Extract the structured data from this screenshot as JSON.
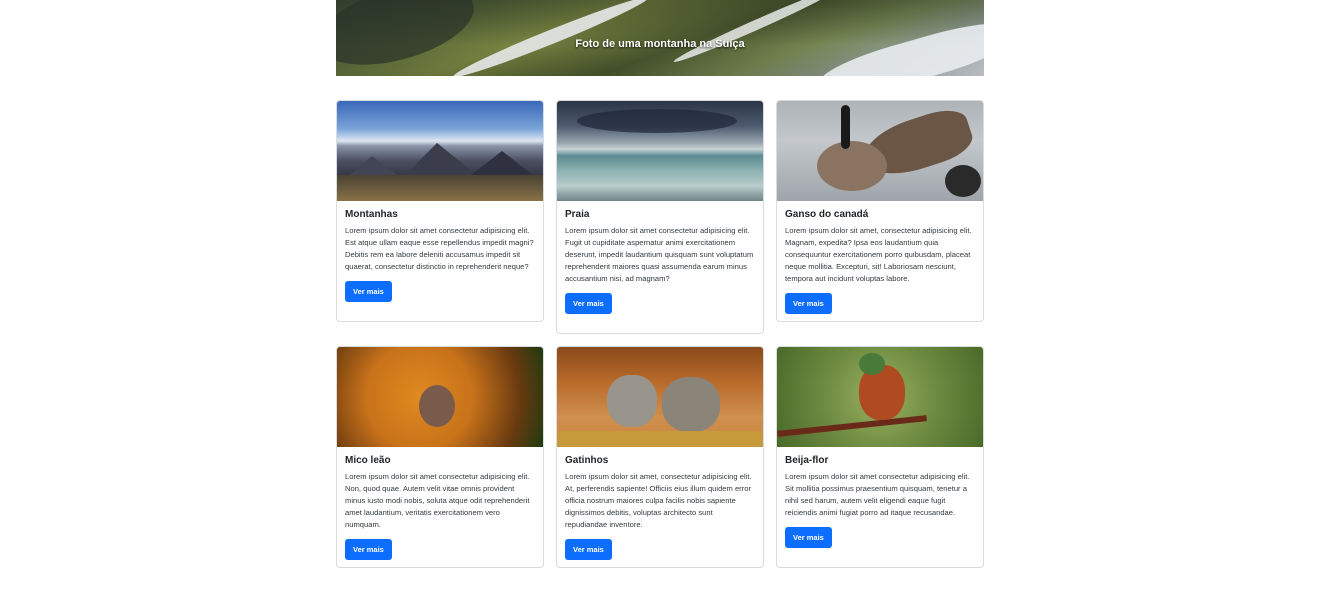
{
  "hero": {
    "caption": "Foto de uma montanha na Suíça"
  },
  "cards": [
    {
      "title": "Montanhas",
      "text": "Lorem ipsum dolor sit amet consectetur adipisicing elit. Est atque ullam eaque esse repellendus impedit magni? Debitis rem ea labore deleniti accusamus impedit sit quaerat, consectetur distinctio in reprehenderit neque?",
      "button": "Ver mais"
    },
    {
      "title": "Praia",
      "text": "Lorem ipsum dolor sit amet consectetur adipisicing elit. Fugit ut cupiditate aspernatur animi exercitationem deserunt, impedit laudantium quisquam sunt voluptatum reprehenderit maiores quasi assumenda earum minus accusantium nisi, ad magnam?",
      "button": "Ver mais"
    },
    {
      "title": "Ganso do canadá",
      "text": "Lorem ipsum dolor sit amet, consectetur adipisicing elit. Magnam, expedita? Ipsa eos laudantium quia consequuntur exercitationem porro quibusdam, placeat neque mollitia. Excepturi, sit! Laboriosam nesciunt, tempora aut incidunt voluptas labore.",
      "button": "Ver mais"
    },
    {
      "title": "Mico leão",
      "text": "Lorem ipsum dolor sit amet consectetur adipisicing elit. Non, quod quae. Autem velit vitae omnis provident minus iusto modi nobis, soluta atque odit reprehenderit amet laudantium, veritatis exercitationem vero numquam.",
      "button": "Ver mais"
    },
    {
      "title": "Gatinhos",
      "text": "Lorem ipsum dolor sit amet, consectetur adipisicing elit. At, perferendis sapiente! Officiis eius illum quidem error officia nostrum maiores culpa facilis nobis sapiente dignissimos debitis, voluptas architecto sunt repudiandae inventore.",
      "button": "Ver mais"
    },
    {
      "title": "Beija-flor",
      "text": "Lorem ipsum dolor sit amet consectetur adipisicing elit. Sit mollitia possimus praesentium quisquam, tenetur a nihil sed harum, autem velit eligendi eaque fugit reiciendis animi fugiat porro ad itaque recusandae.",
      "button": "Ver mais"
    }
  ],
  "colors": {
    "primary_button": "#0d6efd",
    "card_border": "#d9dcdf"
  }
}
